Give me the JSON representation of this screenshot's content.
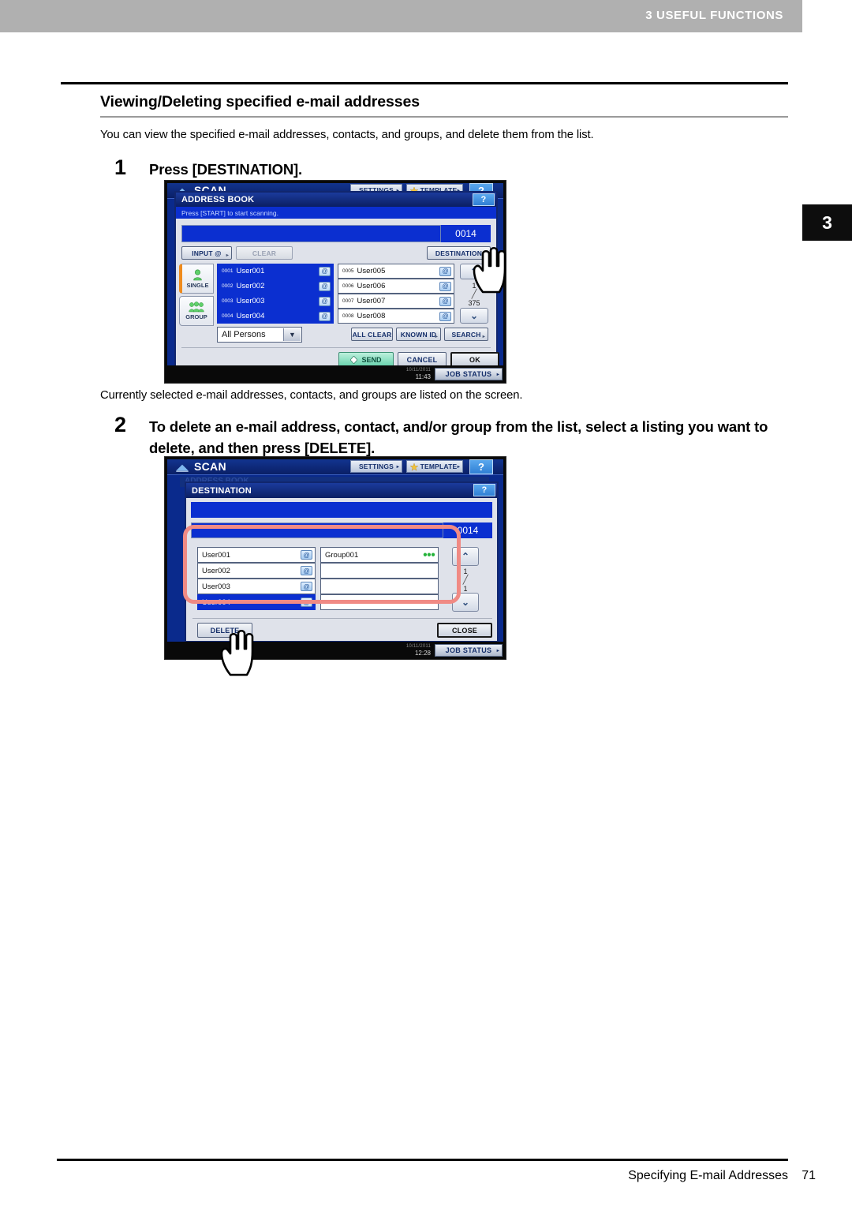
{
  "running_head": {
    "label": "3 USEFUL FUNCTIONS"
  },
  "chapter_tab": {
    "number": "3"
  },
  "section": {
    "title": "Viewing/Deleting specified e-mail addresses",
    "intro": "You can view the specified e-mail addresses, contacts, and groups, and delete them from the list."
  },
  "steps": [
    {
      "number": "1",
      "text": "Press [DESTINATION].",
      "caption": "Currently selected e-mail addresses, contacts, and groups are listed on the screen."
    },
    {
      "number": "2",
      "text": "To delete an e-mail address, contact, and/or group from the list, select a listing you want to delete, and then press [DELETE]."
    }
  ],
  "screen1": {
    "scan_label": "SCAN",
    "toolbar": {
      "settings": "SETTINGS",
      "template": "TEMPLATE",
      "help": "?",
      "arrow": "▸"
    },
    "dialog_title": "ADDRESS BOOK",
    "dialog_help": "?",
    "message": "Press [START] to start scanning.",
    "count": "0014",
    "buttons": {
      "input_at": "INPUT @",
      "clear": "CLEAR",
      "destination": "DESTINATION",
      "all_clear": "ALL CLEAR",
      "known_id": "KNOWN ID",
      "search": "SEARCH",
      "send": "SEND",
      "cancel": "CANCEL",
      "ok": "OK"
    },
    "side_tabs": [
      {
        "label": "SINGLE",
        "icon": "single-person-icon",
        "active": true
      },
      {
        "label": "GROUP",
        "icon": "group-people-icon",
        "active": false
      }
    ],
    "filter": {
      "value": "All Persons",
      "caret": "▼"
    },
    "list_left": [
      {
        "index": "0001",
        "name": "User001",
        "selected": true,
        "icon": "at-icon"
      },
      {
        "index": "0002",
        "name": "User002",
        "selected": true,
        "icon": "at-icon"
      },
      {
        "index": "0003",
        "name": "User003",
        "selected": true,
        "icon": "at-icon"
      },
      {
        "index": "0004",
        "name": "User004",
        "selected": true,
        "icon": "at-icon"
      }
    ],
    "list_right": [
      {
        "index": "0005",
        "name": "User005",
        "selected": false,
        "icon": "at-icon"
      },
      {
        "index": "0006",
        "name": "User006",
        "selected": false,
        "icon": "at-icon"
      },
      {
        "index": "0007",
        "name": "User007",
        "selected": false,
        "icon": "at-icon"
      },
      {
        "index": "0008",
        "name": "User008",
        "selected": false,
        "icon": "at-icon"
      }
    ],
    "pager": {
      "current": "1",
      "separator": "╱",
      "total": "375",
      "up": "⌃",
      "down": "⌄"
    },
    "status": {
      "date": "10/11/2011",
      "time": "11:43",
      "job_status": "JOB STATUS",
      "arrow": "▸"
    }
  },
  "screen2": {
    "scan_label": "SCAN",
    "behind_title": "ADDRESS BOOK",
    "toolbar": {
      "settings": "SETTINGS",
      "template": "TEMPLATE",
      "help": "?",
      "arrow": "▸"
    },
    "dialog_title": "DESTINATION",
    "dialog_help": "?",
    "count": "0014",
    "buttons": {
      "delete": "DELETE",
      "close": "CLOSE"
    },
    "list_left": [
      {
        "name": "User001",
        "selected": false,
        "icon": "at-icon"
      },
      {
        "name": "User002",
        "selected": false,
        "icon": "at-icon"
      },
      {
        "name": "User003",
        "selected": false,
        "icon": "at-icon"
      },
      {
        "name": "User004",
        "selected": true,
        "icon": "at-icon"
      }
    ],
    "list_right": [
      {
        "name": "Group001",
        "selected": false,
        "icon": "group-icon"
      },
      {
        "name": "",
        "selected": false,
        "icon": ""
      },
      {
        "name": "",
        "selected": false,
        "icon": ""
      },
      {
        "name": "",
        "selected": false,
        "icon": ""
      }
    ],
    "pager": {
      "current": "1",
      "separator": "╱",
      "total": "1",
      "up": "⌃",
      "down": "⌄"
    },
    "status": {
      "date": "10/11/2011",
      "time": "12:28",
      "job_status": "JOB STATUS",
      "arrow": "▸"
    }
  },
  "footer": {
    "text": "Specifying E-mail Addresses",
    "page": "71"
  }
}
